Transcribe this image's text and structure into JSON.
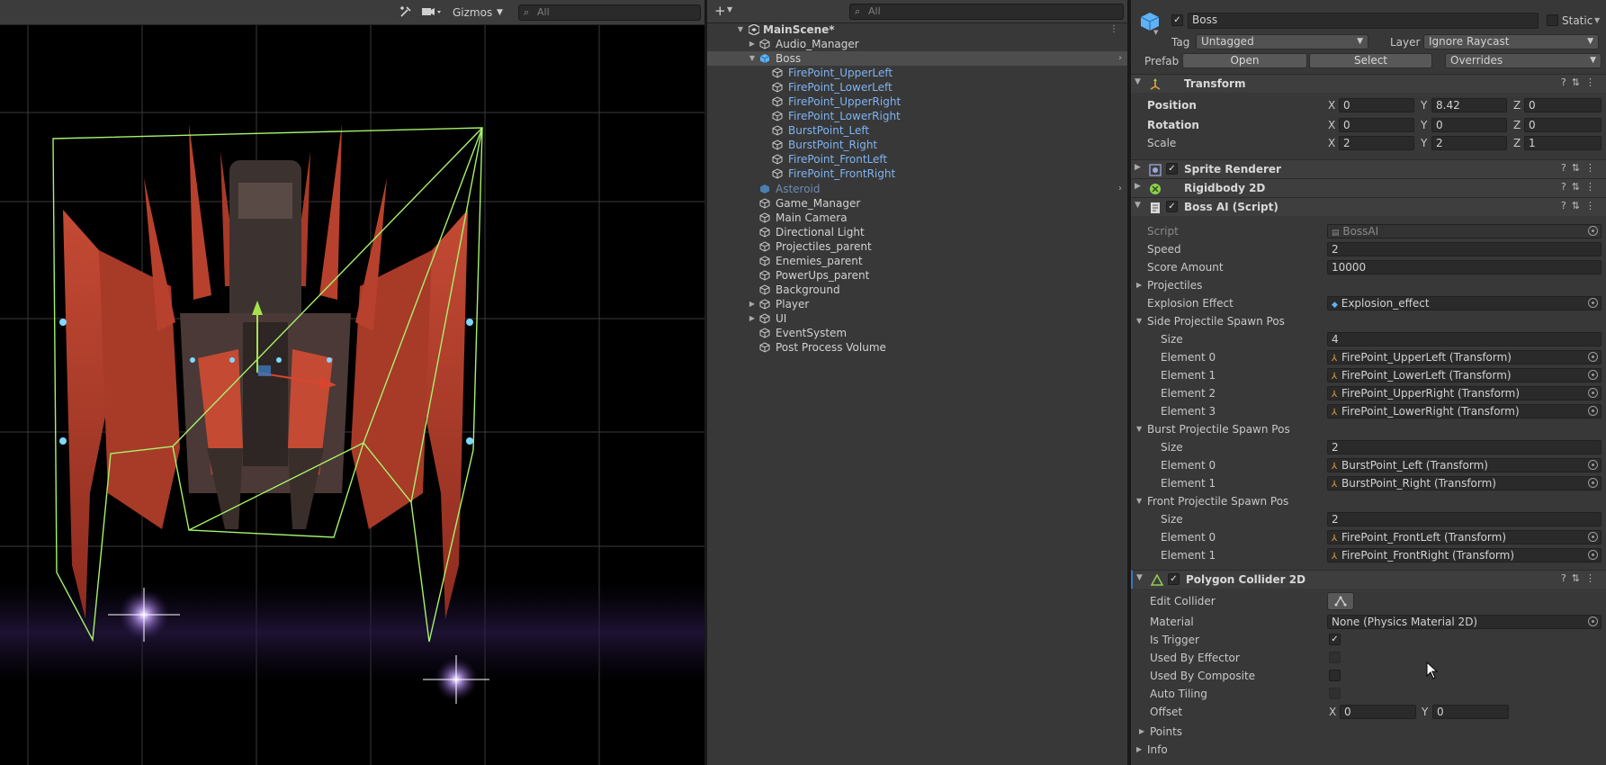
{
  "scene": {
    "toolbar": {
      "gizmos_label": "Gizmos",
      "search_placeholder": "All"
    }
  },
  "hierarchy": {
    "search_placeholder": "All",
    "add_label": "+",
    "scene_name": "MainScene*",
    "items": [
      {
        "label": "Audio_Manager"
      },
      {
        "label": "Boss"
      },
      {
        "label": "FirePoint_UpperLeft"
      },
      {
        "label": "FirePoint_LowerLeft"
      },
      {
        "label": "FirePoint_UpperRight"
      },
      {
        "label": "FirePoint_LowerRight"
      },
      {
        "label": "BurstPoint_Left"
      },
      {
        "label": "BurstPoint_Right"
      },
      {
        "label": "FirePoint_FrontLeft"
      },
      {
        "label": "FirePoint_FrontRight"
      },
      {
        "label": "Asteroid"
      },
      {
        "label": "Game_Manager"
      },
      {
        "label": "Main Camera"
      },
      {
        "label": "Directional Light"
      },
      {
        "label": "Projectiles_parent"
      },
      {
        "label": "Enemies_parent"
      },
      {
        "label": "PowerUps_parent"
      },
      {
        "label": "Background"
      },
      {
        "label": "Player"
      },
      {
        "label": "UI"
      },
      {
        "label": "EventSystem"
      },
      {
        "label": "Post Process Volume"
      }
    ]
  },
  "inspector": {
    "object_name": "Boss",
    "static_label": "Static",
    "tag_label": "Tag",
    "tag_value": "Untagged",
    "layer_label": "Layer",
    "layer_value": "Ignore Raycast",
    "prefab_label": "Prefab",
    "prefab_open": "Open",
    "prefab_select": "Select",
    "prefab_overrides": "Overrides",
    "transform": {
      "title": "Transform",
      "position_label": "Position",
      "pos_x": "0",
      "pos_y": "8.42",
      "pos_z": "0",
      "rotation_label": "Rotation",
      "rot_x": "0",
      "rot_y": "0",
      "rot_z": "0",
      "scale_label": "Scale",
      "scale_x": "2",
      "scale_y": "2",
      "scale_z": "1",
      "x": "X",
      "y": "Y",
      "z": "Z"
    },
    "sprite_renderer_title": "Sprite Renderer",
    "rigidbody_title": "Rigidbody 2D",
    "boss_ai": {
      "title": "Boss AI (Script)",
      "script_label": "Script",
      "script_value": "BossAI",
      "speed_label": "Speed",
      "speed_value": "2",
      "score_label": "Score Amount",
      "score_value": "10000",
      "projectiles_label": "Projectiles",
      "explosion_label": "Explosion Effect",
      "explosion_value": "Explosion_effect",
      "side_label": "Side Projectile Spawn Pos",
      "size_label": "Size",
      "side_size": "4",
      "side_elements": [
        {
          "label": "Element 0",
          "value": "FirePoint_UpperLeft (Transform)"
        },
        {
          "label": "Element 1",
          "value": "FirePoint_LowerLeft (Transform)"
        },
        {
          "label": "Element 2",
          "value": "FirePoint_UpperRight (Transform)"
        },
        {
          "label": "Element 3",
          "value": "FirePoint_LowerRight (Transform)"
        }
      ],
      "burst_label": "Burst Projectile Spawn Pos",
      "burst_size": "2",
      "burst_elements": [
        {
          "label": "Element 0",
          "value": "BurstPoint_Left (Transform)"
        },
        {
          "label": "Element 1",
          "value": "BurstPoint_Right (Transform)"
        }
      ],
      "front_label": "Front Projectile Spawn Pos",
      "front_size": "2",
      "front_elements": [
        {
          "label": "Element 0",
          "value": "FirePoint_FrontLeft (Transform)"
        },
        {
          "label": "Element 1",
          "value": "FirePoint_FrontRight (Transform)"
        }
      ]
    },
    "polygon": {
      "title": "Polygon Collider 2D",
      "edit_label": "Edit Collider",
      "material_label": "Material",
      "material_value": "None (Physics Material 2D)",
      "trigger_label": "Is Trigger",
      "is_trigger": true,
      "effector_label": "Used By Effector",
      "composite_label": "Used By Composite",
      "tiling_label": "Auto Tiling",
      "offset_label": "Offset",
      "offset_x": "0",
      "offset_y": "0",
      "points_label": "Points",
      "info_label": "Info"
    }
  },
  "colors": {
    "collider": "#a6f26b",
    "ship_red": "#b8402e",
    "prefab_blue": "#7fb3f2",
    "accent": "#3a79bb"
  }
}
